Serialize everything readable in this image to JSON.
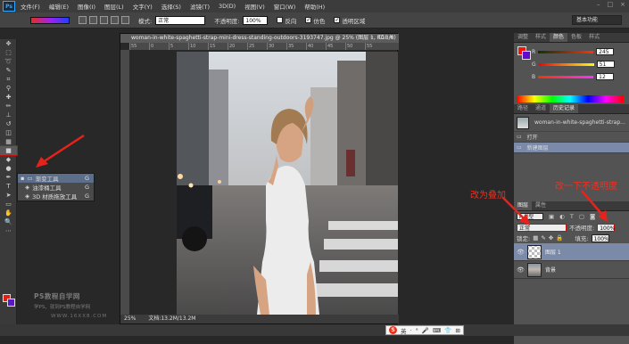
{
  "menubar": {
    "logo": "Ps",
    "items": [
      "文件(F)",
      "编辑(E)",
      "图像(I)",
      "图层(L)",
      "文字(Y)",
      "选择(S)",
      "滤镜(T)",
      "3D(D)",
      "视图(V)",
      "窗口(W)",
      "帮助(H)"
    ],
    "window_controls": [
      "–",
      "□",
      "×"
    ]
  },
  "options": {
    "mode_label": "模式:",
    "mode_value": "正常",
    "opacity_label": "不透明度:",
    "opacity_value": "100%",
    "reverse_label": "反向",
    "dither_label": "仿色",
    "transparency_label": "透明区域",
    "workspace": "基本功能"
  },
  "tool_flyout": {
    "items": [
      {
        "label": "渐变工具",
        "key": "G"
      },
      {
        "label": "油漆桶工具",
        "key": "G"
      },
      {
        "label": "3D 材质拖放工具",
        "key": "G"
      }
    ]
  },
  "watermark": {
    "line1": "PS教程自学网",
    "line2": "学PS，就到PS教程自学网",
    "line3": "WWW.16XX8.COM"
  },
  "document": {
    "tab_title": "woman-in-white-spaghetti-strap-mini-dress-standing-outdoors-3193747.jpg @ 25% (图层 1, RGB/8)",
    "ruler_marks": [
      "55",
      "0",
      "5",
      "10",
      "15",
      "20",
      "25",
      "30",
      "35",
      "40",
      "45",
      "50",
      "55"
    ],
    "zoom": "25%",
    "doc_size": "文档:13.2M/13.2M"
  },
  "color_panel": {
    "tabs": [
      "调整",
      "样式",
      "颜色",
      "色板",
      "样式"
    ],
    "active_tab": 2,
    "channels": [
      {
        "label": "R",
        "value": "245"
      },
      {
        "label": "G",
        "value": "51"
      },
      {
        "label": "B",
        "value": "12"
      }
    ],
    "foreground": "#f51507",
    "background": "#600cd0"
  },
  "history_panel": {
    "tabs": [
      "路径",
      "通道",
      "历史记录"
    ],
    "active_tab": 2,
    "snapshot": "woman-in-white-spaghetti-strap...",
    "states": [
      "打开",
      "新建图层"
    ]
  },
  "layers_panel": {
    "tabs": [
      "图层",
      "属性"
    ],
    "kind_filter": "P 类型",
    "blend_mode": "正常",
    "opacity_label": "不透明度:",
    "opacity_value": "100%",
    "lock_label": "锁定:",
    "fill_label": "填充:",
    "fill_value": "100%",
    "layers": [
      {
        "name": "图层 1",
        "thumb": "transparent",
        "selected": true
      },
      {
        "name": "背景",
        "thumb": "image",
        "selected": false
      }
    ]
  },
  "annotations": {
    "change_overlay": "改为叠加",
    "opacity_hint": "改一下不透明度"
  },
  "taskbar": {
    "ime_logo": "S",
    "ime_items": [
      "英",
      "·",
      "°",
      "🎤",
      "⌨",
      "👕",
      "⊞"
    ]
  }
}
